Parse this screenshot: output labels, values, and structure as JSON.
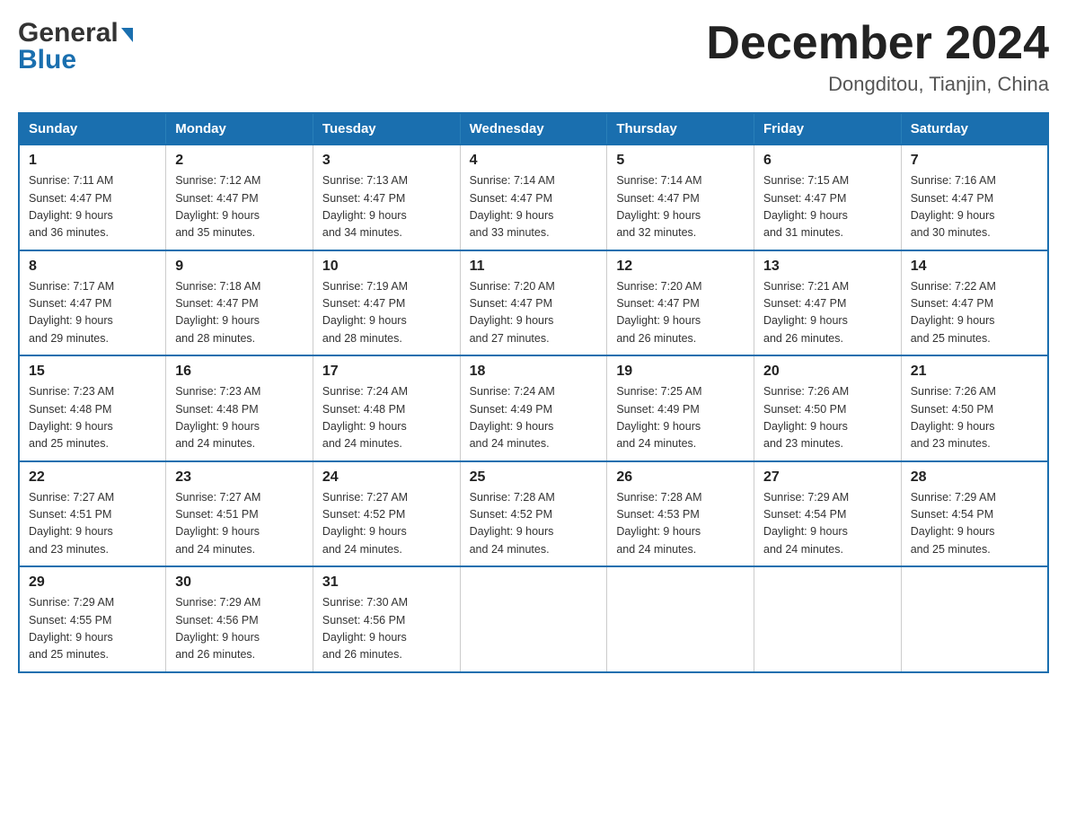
{
  "header": {
    "logo_general": "General",
    "logo_blue": "Blue",
    "month_title": "December 2024",
    "location": "Dongditou, Tianjin, China"
  },
  "days_of_week": [
    "Sunday",
    "Monday",
    "Tuesday",
    "Wednesday",
    "Thursday",
    "Friday",
    "Saturday"
  ],
  "weeks": [
    [
      {
        "day": "1",
        "sunrise": "7:11 AM",
        "sunset": "4:47 PM",
        "daylight": "9 hours and 36 minutes."
      },
      {
        "day": "2",
        "sunrise": "7:12 AM",
        "sunset": "4:47 PM",
        "daylight": "9 hours and 35 minutes."
      },
      {
        "day": "3",
        "sunrise": "7:13 AM",
        "sunset": "4:47 PM",
        "daylight": "9 hours and 34 minutes."
      },
      {
        "day": "4",
        "sunrise": "7:14 AM",
        "sunset": "4:47 PM",
        "daylight": "9 hours and 33 minutes."
      },
      {
        "day": "5",
        "sunrise": "7:14 AM",
        "sunset": "4:47 PM",
        "daylight": "9 hours and 32 minutes."
      },
      {
        "day": "6",
        "sunrise": "7:15 AM",
        "sunset": "4:47 PM",
        "daylight": "9 hours and 31 minutes."
      },
      {
        "day": "7",
        "sunrise": "7:16 AM",
        "sunset": "4:47 PM",
        "daylight": "9 hours and 30 minutes."
      }
    ],
    [
      {
        "day": "8",
        "sunrise": "7:17 AM",
        "sunset": "4:47 PM",
        "daylight": "9 hours and 29 minutes."
      },
      {
        "day": "9",
        "sunrise": "7:18 AM",
        "sunset": "4:47 PM",
        "daylight": "9 hours and 28 minutes."
      },
      {
        "day": "10",
        "sunrise": "7:19 AM",
        "sunset": "4:47 PM",
        "daylight": "9 hours and 28 minutes."
      },
      {
        "day": "11",
        "sunrise": "7:20 AM",
        "sunset": "4:47 PM",
        "daylight": "9 hours and 27 minutes."
      },
      {
        "day": "12",
        "sunrise": "7:20 AM",
        "sunset": "4:47 PM",
        "daylight": "9 hours and 26 minutes."
      },
      {
        "day": "13",
        "sunrise": "7:21 AM",
        "sunset": "4:47 PM",
        "daylight": "9 hours and 26 minutes."
      },
      {
        "day": "14",
        "sunrise": "7:22 AM",
        "sunset": "4:47 PM",
        "daylight": "9 hours and 25 minutes."
      }
    ],
    [
      {
        "day": "15",
        "sunrise": "7:23 AM",
        "sunset": "4:48 PM",
        "daylight": "9 hours and 25 minutes."
      },
      {
        "day": "16",
        "sunrise": "7:23 AM",
        "sunset": "4:48 PM",
        "daylight": "9 hours and 24 minutes."
      },
      {
        "day": "17",
        "sunrise": "7:24 AM",
        "sunset": "4:48 PM",
        "daylight": "9 hours and 24 minutes."
      },
      {
        "day": "18",
        "sunrise": "7:24 AM",
        "sunset": "4:49 PM",
        "daylight": "9 hours and 24 minutes."
      },
      {
        "day": "19",
        "sunrise": "7:25 AM",
        "sunset": "4:49 PM",
        "daylight": "9 hours and 24 minutes."
      },
      {
        "day": "20",
        "sunrise": "7:26 AM",
        "sunset": "4:50 PM",
        "daylight": "9 hours and 23 minutes."
      },
      {
        "day": "21",
        "sunrise": "7:26 AM",
        "sunset": "4:50 PM",
        "daylight": "9 hours and 23 minutes."
      }
    ],
    [
      {
        "day": "22",
        "sunrise": "7:27 AM",
        "sunset": "4:51 PM",
        "daylight": "9 hours and 23 minutes."
      },
      {
        "day": "23",
        "sunrise": "7:27 AM",
        "sunset": "4:51 PM",
        "daylight": "9 hours and 24 minutes."
      },
      {
        "day": "24",
        "sunrise": "7:27 AM",
        "sunset": "4:52 PM",
        "daylight": "9 hours and 24 minutes."
      },
      {
        "day": "25",
        "sunrise": "7:28 AM",
        "sunset": "4:52 PM",
        "daylight": "9 hours and 24 minutes."
      },
      {
        "day": "26",
        "sunrise": "7:28 AM",
        "sunset": "4:53 PM",
        "daylight": "9 hours and 24 minutes."
      },
      {
        "day": "27",
        "sunrise": "7:29 AM",
        "sunset": "4:54 PM",
        "daylight": "9 hours and 24 minutes."
      },
      {
        "day": "28",
        "sunrise": "7:29 AM",
        "sunset": "4:54 PM",
        "daylight": "9 hours and 25 minutes."
      }
    ],
    [
      {
        "day": "29",
        "sunrise": "7:29 AM",
        "sunset": "4:55 PM",
        "daylight": "9 hours and 25 minutes."
      },
      {
        "day": "30",
        "sunrise": "7:29 AM",
        "sunset": "4:56 PM",
        "daylight": "9 hours and 26 minutes."
      },
      {
        "day": "31",
        "sunrise": "7:30 AM",
        "sunset": "4:56 PM",
        "daylight": "9 hours and 26 minutes."
      },
      null,
      null,
      null,
      null
    ]
  ],
  "labels": {
    "sunrise": "Sunrise:",
    "sunset": "Sunset:",
    "daylight": "Daylight:"
  }
}
